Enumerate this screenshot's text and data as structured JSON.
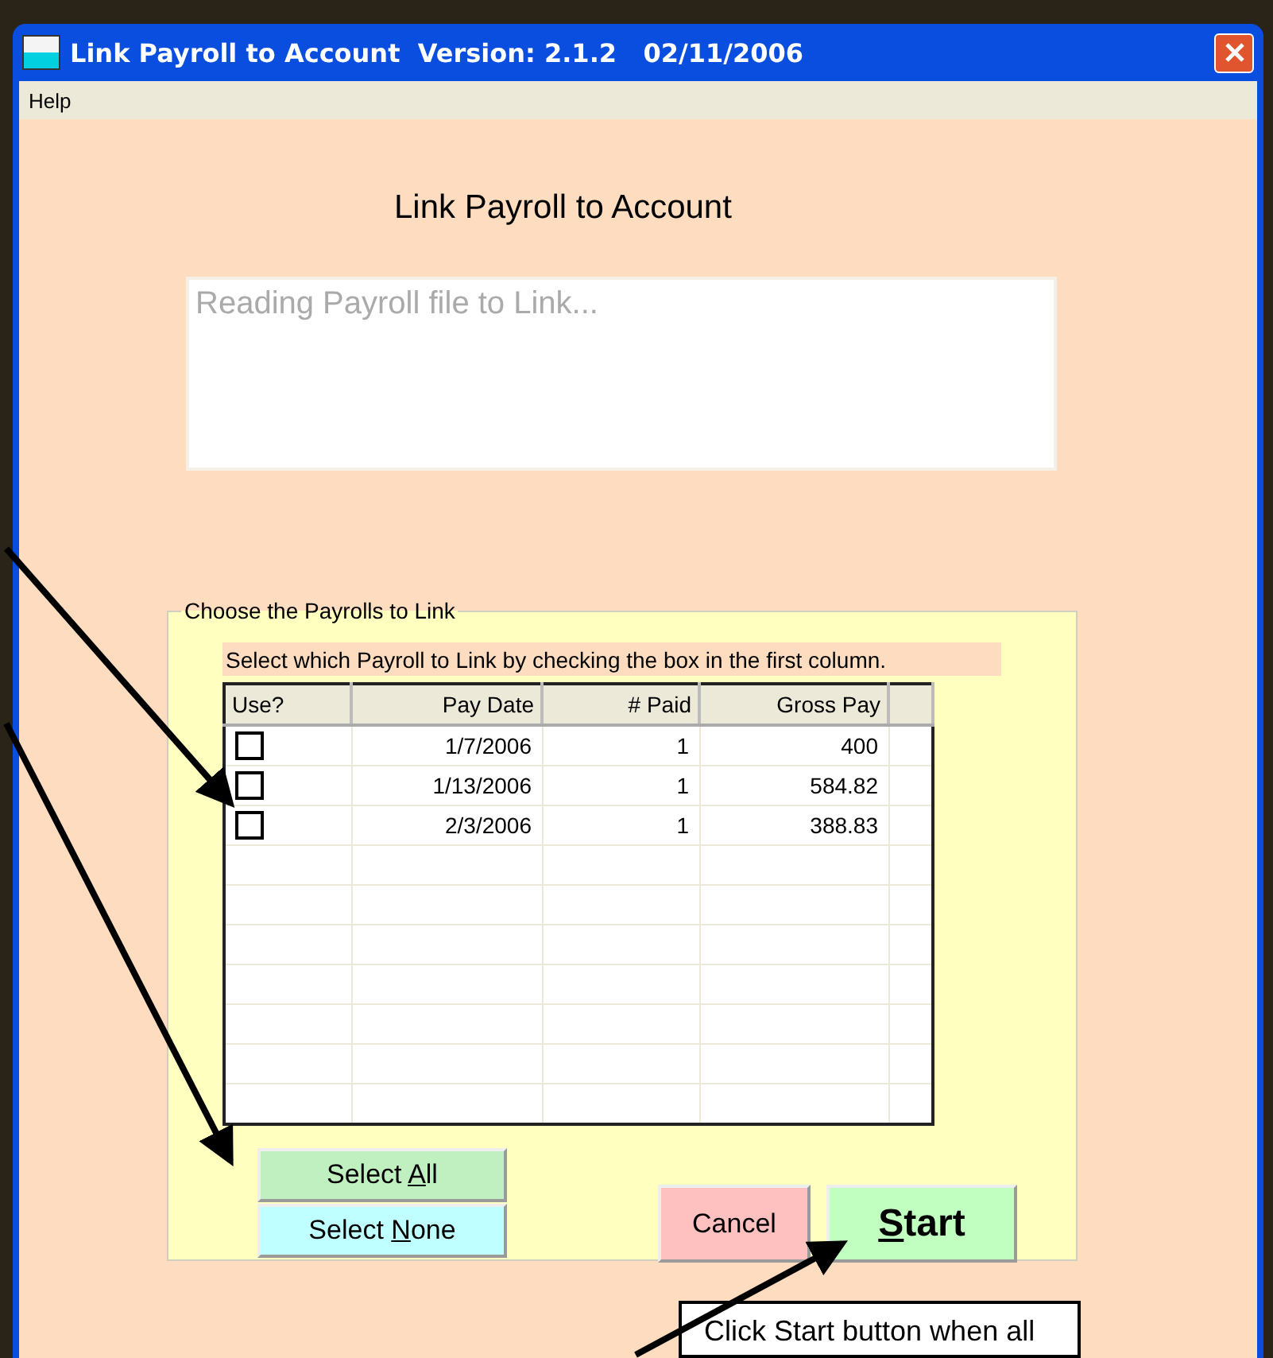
{
  "window": {
    "title": "Link Payroll to Account  Version: 2.1.2   02/11/2006"
  },
  "menu": [
    "Help"
  ],
  "heading": "Link Payroll to Account",
  "status_box": {
    "placeholder": "Reading Payroll file to Link..."
  },
  "group": {
    "title": "Choose the Payrolls to Link",
    "instruction": "Select which Payroll to Link by checking the box in the first column.",
    "table": {
      "columns": [
        "Use?",
        "Pay Date",
        "# Paid",
        "Gross Pay"
      ],
      "rows": [
        {
          "checked": false,
          "pay_date": "1/7/2006",
          "paid": "1",
          "gross_pay": "400"
        },
        {
          "checked": false,
          "pay_date": "1/13/2006",
          "paid": "1",
          "gross_pay": "584.82"
        },
        {
          "checked": false,
          "pay_date": "2/3/2006",
          "paid": "1",
          "gross_pay": "388.83"
        }
      ]
    },
    "buttons": [
      {
        "kind": "select",
        "label": {
          "before": "Select ",
          "key": "A",
          "after": "ll"
        },
        "color": "#c0f0c0"
      },
      {
        "kind": "select",
        "label": {
          "before": "Select ",
          "key": "N",
          "after": "one"
        },
        "color": "#c0ffff"
      },
      {
        "kind": "action",
        "label": {
          "after": "Cancel"
        },
        "color": "#ffc0c0"
      },
      {
        "kind": "primary",
        "label": {
          "key": "S",
          "after": "tart"
        },
        "color": "#c0ffc0"
      }
    ]
  },
  "callout": "Click Start button when all"
}
